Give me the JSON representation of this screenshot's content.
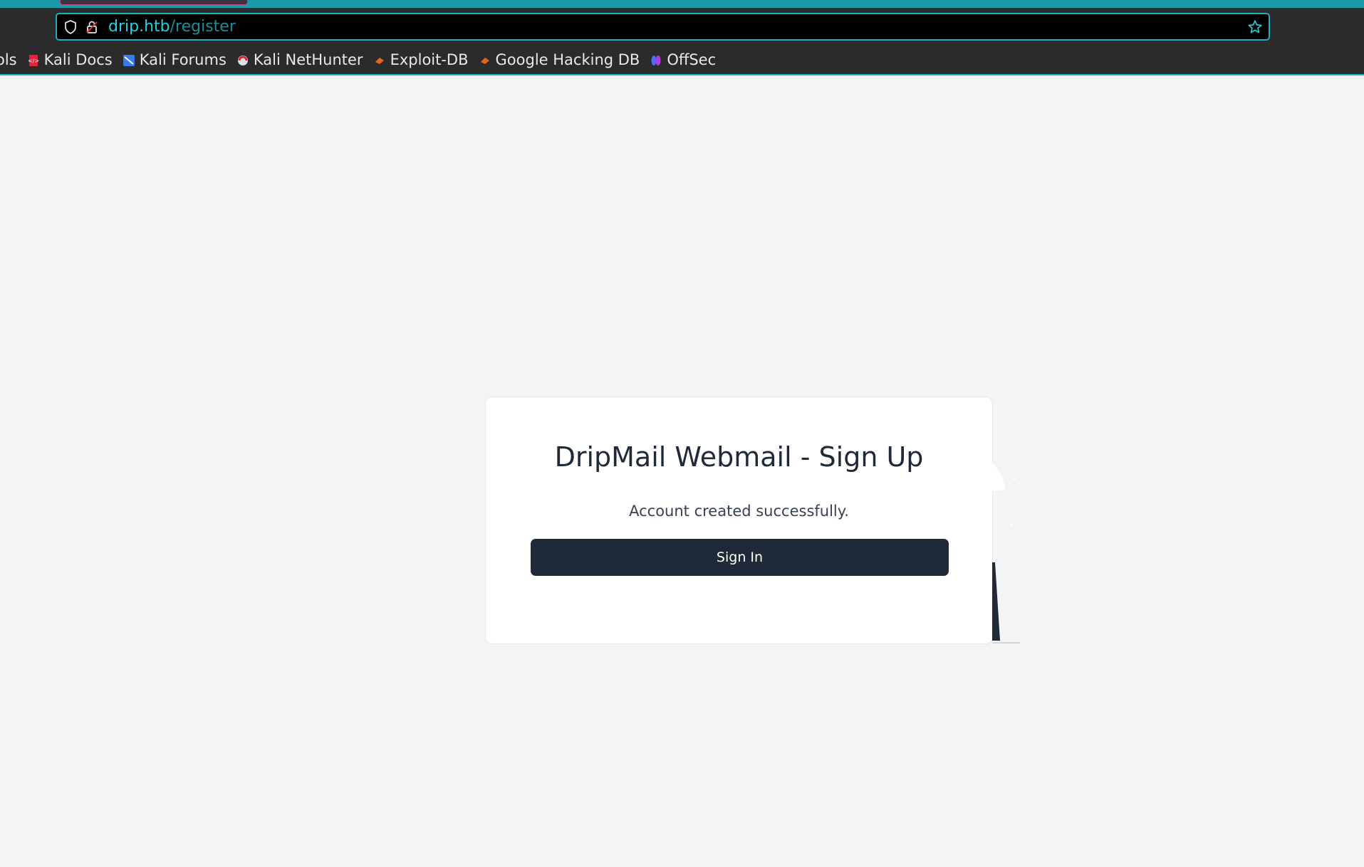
{
  "browser": {
    "url_host": "drip.htb",
    "url_path": "/register",
    "accent": "#17b3c2",
    "bookmarks_cut_label": "ols",
    "bookmarks": [
      {
        "label": "Kali Docs",
        "icon": "kali-docs-icon"
      },
      {
        "label": "Kali Forums",
        "icon": "kali-forums-icon"
      },
      {
        "label": "Kali NetHunter",
        "icon": "kali-nethunter-icon"
      },
      {
        "label": "Exploit-DB",
        "icon": "exploit-db-icon"
      },
      {
        "label": "Google Hacking DB",
        "icon": "google-hacking-db-icon"
      },
      {
        "label": "OffSec",
        "icon": "offsec-icon"
      }
    ]
  },
  "card": {
    "title": "DripMail Webmail - Sign Up",
    "message": "Account created successfully.",
    "button_label": "Sign In",
    "button_color": "#1f2937"
  }
}
